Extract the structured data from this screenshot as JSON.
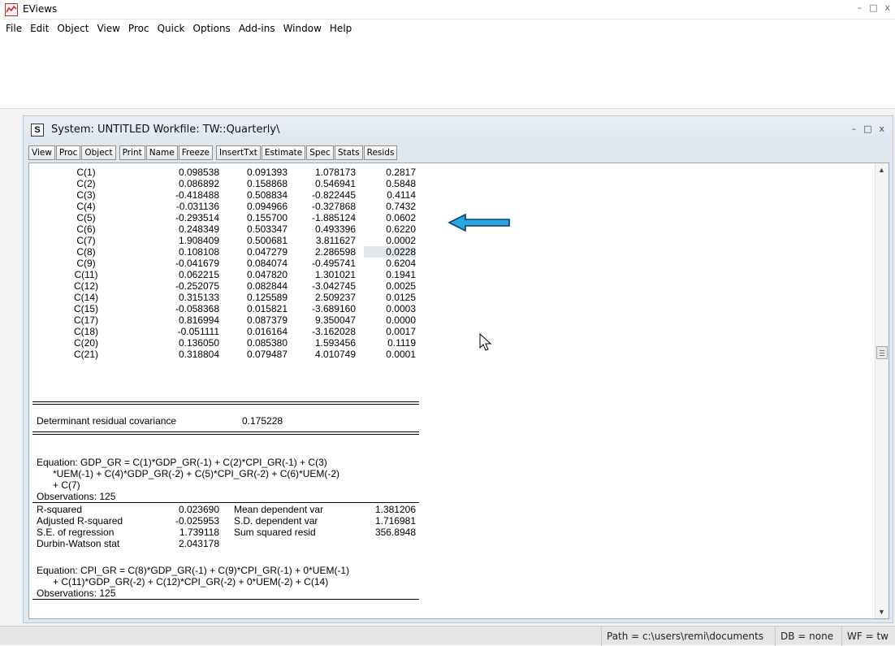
{
  "app": {
    "title": "EViews",
    "window_controls": [
      "–",
      "□",
      "x"
    ]
  },
  "menu": [
    "File",
    "Edit",
    "Object",
    "View",
    "Proc",
    "Quick",
    "Options",
    "Add-ins",
    "Window",
    "Help"
  ],
  "object_window": {
    "badge": "S",
    "title": "System: UNTITLED   Workfile: TW::Quarterly\\",
    "controls": [
      "–",
      "□",
      "x"
    ],
    "toolbar": [
      "View",
      "Proc",
      "Object",
      "Print",
      "Name",
      "Freeze",
      "InsertTxt",
      "Estimate",
      "Spec",
      "Stats",
      "Resids"
    ]
  },
  "coefficients": [
    {
      "name": "C(1)",
      "coef": "0.098538",
      "se": "0.091393",
      "t": "1.078173",
      "p": "0.2817"
    },
    {
      "name": "C(2)",
      "coef": "0.086892",
      "se": "0.158868",
      "t": "0.546941",
      "p": "0.5848"
    },
    {
      "name": "C(3)",
      "coef": "-0.418488",
      "se": "0.508834",
      "t": "-0.822445",
      "p": "0.4114"
    },
    {
      "name": "C(4)",
      "coef": "-0.031136",
      "se": "0.094966",
      "t": "-0.327868",
      "p": "0.7432"
    },
    {
      "name": "C(5)",
      "coef": "-0.293514",
      "se": "0.155700",
      "t": "-1.885124",
      "p": "0.0602"
    },
    {
      "name": "C(6)",
      "coef": "0.248349",
      "se": "0.503347",
      "t": "0.493396",
      "p": "0.6220"
    },
    {
      "name": "C(7)",
      "coef": "1.908409",
      "se": "0.500681",
      "t": "3.811627",
      "p": "0.0002"
    },
    {
      "name": "C(8)",
      "coef": "0.108108",
      "se": "0.047279",
      "t": "2.286598",
      "p": "0.0228"
    },
    {
      "name": "C(9)",
      "coef": "-0.041679",
      "se": "0.084074",
      "t": "-0.495741",
      "p": "0.6204"
    },
    {
      "name": "C(11)",
      "coef": "0.062215",
      "se": "0.047820",
      "t": "1.301021",
      "p": "0.1941"
    },
    {
      "name": "C(12)",
      "coef": "-0.252075",
      "se": "0.082844",
      "t": "-3.042745",
      "p": "0.0025"
    },
    {
      "name": "C(14)",
      "coef": "0.315133",
      "se": "0.125589",
      "t": "2.509237",
      "p": "0.0125"
    },
    {
      "name": "C(15)",
      "coef": "-0.058368",
      "se": "0.015821",
      "t": "-3.689160",
      "p": "0.0003"
    },
    {
      "name": "C(17)",
      "coef": "0.816994",
      "se": "0.087379",
      "t": "9.350047",
      "p": "0.0000"
    },
    {
      "name": "C(18)",
      "coef": "-0.051111",
      "se": "0.016164",
      "t": "-3.162028",
      "p": "0.0017"
    },
    {
      "name": "C(20)",
      "coef": "0.136050",
      "se": "0.085380",
      "t": "1.593456",
      "p": "0.1119"
    },
    {
      "name": "C(21)",
      "coef": "0.318804",
      "se": "0.079487",
      "t": "4.010749",
      "p": "0.0001"
    }
  ],
  "determinant": {
    "label": "Determinant residual covariance",
    "value": "0.175228"
  },
  "equation1": {
    "lines": [
      "Equation: GDP_GR = C(1)*GDP_GR(-1) + C(2)*CPI_GR(-1) + C(3)",
      "*UEM(-1) + C(4)*GDP_GR(-2) + C(5)*CPI_GR(-2) + C(6)*UEM(-2)",
      "+ C(7)"
    ],
    "observations": "Observations: 125",
    "stats": [
      {
        "l1": "R-squared",
        "v1": "0.023690",
        "l2": "Mean dependent var",
        "v2": "1.381206"
      },
      {
        "l1": "Adjusted R-squared",
        "v1": "-0.025953",
        "l2": "S.D. dependent var",
        "v2": "1.716981"
      },
      {
        "l1": "S.E. of regression",
        "v1": "1.739118",
        "l2": "Sum squared resid",
        "v2": "356.8948"
      },
      {
        "l1": "Durbin-Watson stat",
        "v1": "2.043178",
        "l2": "",
        "v2": ""
      }
    ]
  },
  "equation2": {
    "lines": [
      "Equation: CPI_GR = C(8)*GDP_GR(-1) + C(9)*CPI_GR(-1) + 0*UEM(-1)",
      "+ C(11)*GDP_GR(-2) + C(12)*CPI_GR(-2) + 0*UEM(-2) + C(14)"
    ],
    "observations": "Observations: 125"
  },
  "annotation": {
    "arrow_color": "#29a6e0",
    "icon": "left-arrow-icon"
  },
  "statusbar": {
    "path": "Path = c:\\users\\remi\\documents",
    "db": "DB = none",
    "wf": "WF = tw"
  }
}
